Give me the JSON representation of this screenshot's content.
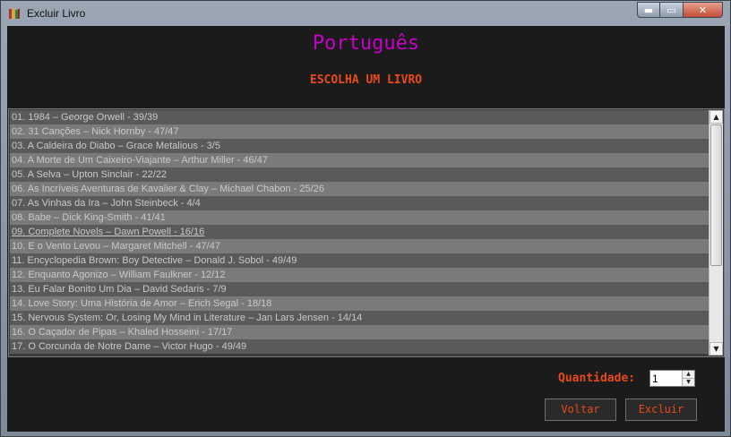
{
  "window": {
    "title": "Excluir Livro",
    "controls": {
      "minimize": "▬",
      "maximize": "▭",
      "close": "✕"
    }
  },
  "heading": "Português",
  "subheading": "ESCOLHA UM LIVRO",
  "books": [
    "01. 1984 – George Orwell - 39/39",
    "02. 31 Canções – Nick Hornby - 47/47",
    "03. A Caldeira do Diabo – Grace Metalious - 3/5",
    "04. A Morte de Um Caixeiro-Viajante – Arthur Miller - 46/47",
    "05. A Selva – Upton Sinclair - 22/22",
    "06. As Incríveis Aventuras de Kavalier & Clay – Michael Chabon - 25/26",
    "07. As Vinhas da Ira – John Steinbeck - 4/4",
    "08. Babe – Dick King-Smith - 41/41",
    "09. Complete Novels – Dawn Powell - 16/16",
    "10. E o Vento Levou – Margaret Mitchell - 47/47",
    "11. Encyclopedia Brown: Boy Detective – Donald J. Sobol - 49/49",
    "12. Enquanto Agonizo – William Faulkner - 12/12",
    "13. Eu Falar Bonito Um Dia – David Sedaris - 7/9",
    "14. Love Story: Uma História de Amor – Erich Segal - 18/18",
    "15. Nervous System: Or, Losing My Mind in Literature – Jan Lars Jensen - 14/14",
    "16. O Caçador de Pipas – Khaled Hosseini - 17/17",
    "17. O Corcunda de Notre Dame – Victor Hugo - 49/49"
  ],
  "quantity": {
    "label": "Quantidade:",
    "value": "1"
  },
  "buttons": {
    "back": "Voltar",
    "delete": "Excluir"
  },
  "colors": {
    "heading": "#c800c8",
    "accent": "#e84a1a",
    "background": "#1b1b1b"
  }
}
